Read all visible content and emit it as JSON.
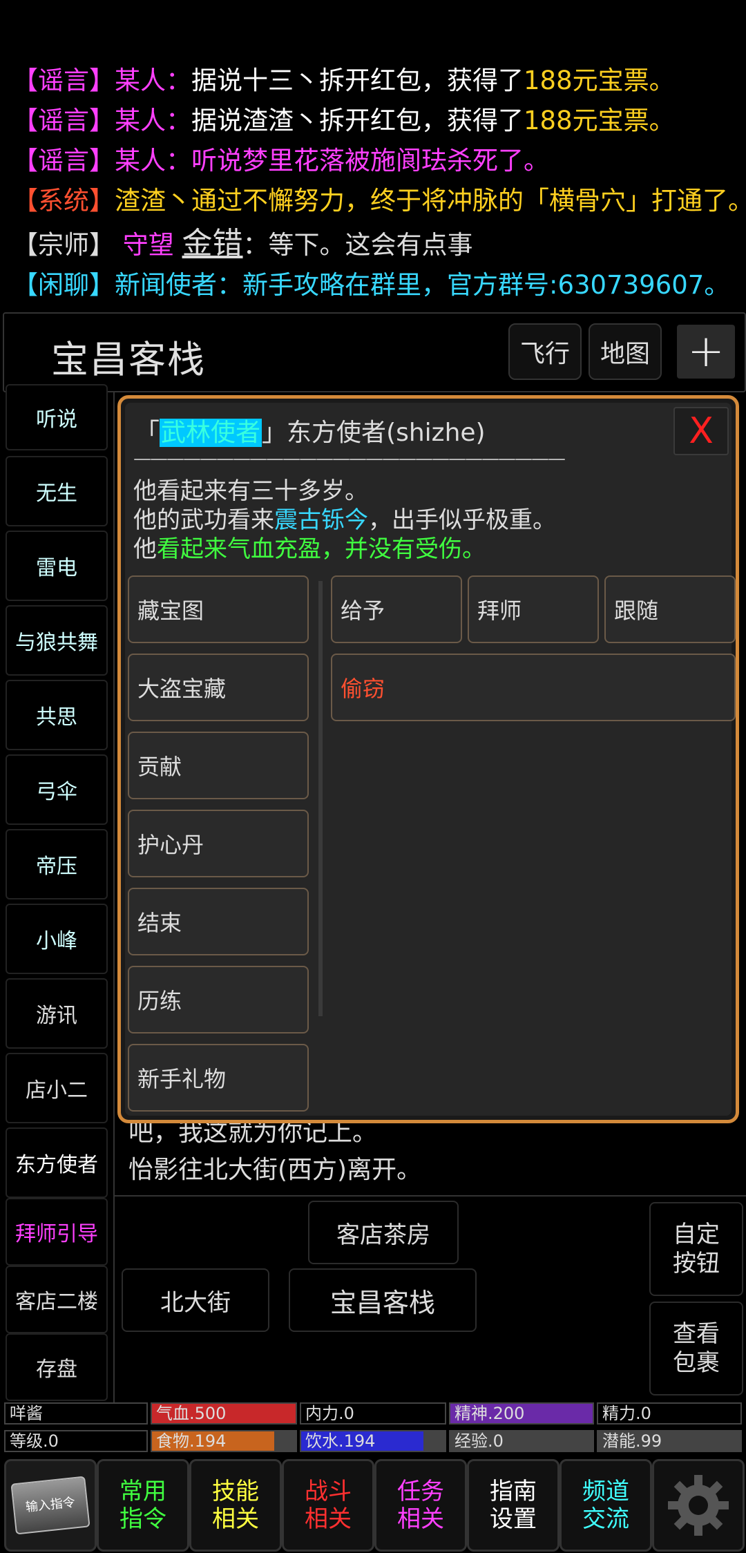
{
  "chat": [
    {
      "tag": "【谣言】",
      "tag_color": "#ff40ff",
      "who": "某人：",
      "who_color": "#ff40ff",
      "text": "据说十三丶拆开红包，获得了",
      "text_color": "#ffffff",
      "extra": "188元宝票。",
      "extra_color": "#ffd020"
    },
    {
      "tag": "【谣言】",
      "tag_color": "#ff40ff",
      "who": "某人：",
      "who_color": "#ff40ff",
      "text": "据说渣渣丶拆开红包，获得了",
      "text_color": "#ffffff",
      "extra": "188元宝票。",
      "extra_color": "#ffd020"
    },
    {
      "tag": "【谣言】",
      "tag_color": "#ff40ff",
      "who": "某人：",
      "who_color": "#ff40ff",
      "text": "听说梦里花落被施阆珐杀死了。",
      "text_color": "#ff40ff",
      "extra": "",
      "extra_color": "#ff40ff"
    },
    {
      "tag": "【系统】",
      "tag_color": "#ff5030",
      "who": "",
      "who_color": "#ffd020",
      "text": "渣渣丶通过不懈努力，终于将冲脉的「横骨穴」打通了。",
      "text_color": "#ffd020",
      "extra": "",
      "extra_color": "#ffd020"
    },
    {
      "tag": "【宗师】",
      "tag_color": "#dddddd",
      "who": "守望",
      "who_color": "#ff40ff",
      "text": "金错",
      "text_color": "#dddddd",
      "extra": "：等下。这会有点事",
      "extra_color": "#dddddd"
    },
    {
      "tag": "【闲聊】",
      "tag_color": "#38d8ff",
      "who": "新闻使者：",
      "who_color": "#38d8ff",
      "text": "新手攻略在群里，官方群号:630739607。",
      "text_color": "#38d8ff",
      "extra": "",
      "extra_color": "#38d8ff"
    }
  ],
  "location": {
    "name": "宝昌客栈",
    "fly": "飞行",
    "map": "地图",
    "plus": "+"
  },
  "sidebar": [
    {
      "label": "听说",
      "color": "#cfffff"
    },
    {
      "label": "无生",
      "color": "#cfffff"
    },
    {
      "label": "雷电",
      "color": "#cfffff"
    },
    {
      "label": "与狼共舞",
      "color": "#cfffff"
    },
    {
      "label": "共思",
      "color": "#cfffff"
    },
    {
      "label": "弓伞",
      "color": "#cfffff"
    },
    {
      "label": "帝压",
      "color": "#cfffff"
    },
    {
      "label": "小峰",
      "color": "#cfffff"
    },
    {
      "label": "游讯",
      "color": "#dddddd"
    },
    {
      "label": "店小二",
      "color": "#dddddd"
    },
    {
      "label": "东方使者",
      "color": "#ffffff"
    },
    {
      "label": "拜师引导",
      "color": "#ff40ff"
    },
    {
      "label": "客店二楼",
      "color": "#dddddd"
    },
    {
      "label": "存盘",
      "color": "#dddddd"
    }
  ],
  "behind_text": {
    "line1": "吧，我这就为你记上。",
    "line2": "怡影往北大街(西方)离开。"
  },
  "modal": {
    "bracket_open": "「",
    "tag": "武林使者",
    "bracket_close": "」",
    "name": "东方使者",
    "pinyin": "(shizhe)",
    "close": "X",
    "divider": "——————————————————————————",
    "desc1": "他看起来有三十多岁。",
    "desc2_a": "他的武功看来",
    "desc2_b": "震古铄今",
    "desc2_c": "，出手似乎极重。",
    "desc3_a": "他",
    "desc3_b": "看起来气血充盈，并没有受伤。",
    "left_actions": [
      "藏宝图",
      "大盗宝藏",
      "贡献",
      "护心丹",
      "结束",
      "历练",
      "新手礼物"
    ],
    "right_actions": [
      "给予",
      "拜师",
      "跟随"
    ],
    "steal": "偷窃"
  },
  "nav": {
    "teahouse": "客店茶房",
    "north": "北大街",
    "inn": "宝昌客栈",
    "custom": "自定\n按钮",
    "bag": "查看\n包裹"
  },
  "stats": [
    {
      "label": "咩酱",
      "fill": 0,
      "color": "#000000"
    },
    {
      "label": "气血.500",
      "fill": 1.0,
      "color": "#c8282a"
    },
    {
      "label": "内力.0",
      "fill": 0,
      "color": "#000000"
    },
    {
      "label": "精神.200",
      "fill": 1.0,
      "color": "#6a2aa8"
    },
    {
      "label": "精力.0",
      "fill": 0,
      "color": "#000000"
    },
    {
      "label": "等级.0",
      "fill": 0,
      "color": "#000000"
    },
    {
      "label": "食物.194",
      "fill": 0.85,
      "color": "#c8641e"
    },
    {
      "label": "饮水.194",
      "fill": 0.85,
      "color": "#2a2ad0"
    },
    {
      "label": "经验.0",
      "fill": 0,
      "color": "#000000"
    },
    {
      "label": "潜能.99",
      "fill": 0,
      "color": "#000000"
    }
  ],
  "tabs": [
    {
      "l1": "常用",
      "l2": "指令",
      "color": "#40ff40"
    },
    {
      "l1": "技能",
      "l2": "相关",
      "color": "#ffff40"
    },
    {
      "l1": "战斗",
      "l2": "相关",
      "color": "#ff3030"
    },
    {
      "l1": "任务",
      "l2": "相关",
      "color": "#ff40ff"
    },
    {
      "l1": "指南",
      "l2": "设置",
      "color": "#ffffff"
    },
    {
      "l1": "频道",
      "l2": "交流",
      "color": "#40ffff"
    }
  ],
  "input_cmd": "输入指令"
}
